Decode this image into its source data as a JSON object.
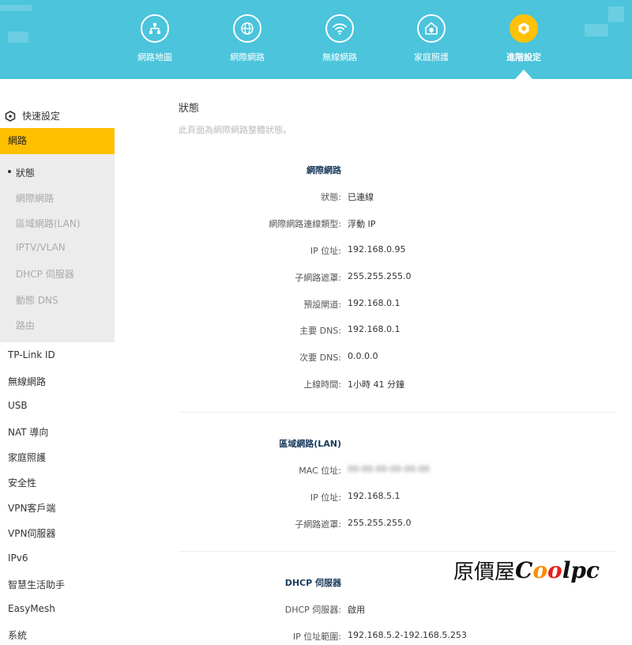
{
  "nav": {
    "tabs": [
      {
        "label": "網路地圖",
        "icon": "network-map-icon"
      },
      {
        "label": "網際網路",
        "icon": "globe-icon"
      },
      {
        "label": "無線網路",
        "icon": "wifi-icon"
      },
      {
        "label": "家庭照護",
        "icon": "home-shield-icon"
      },
      {
        "label": "進階設定",
        "icon": "gear-icon",
        "active": true
      }
    ],
    "active_color": "#ffc107",
    "bar_color": "#4bc4dc"
  },
  "sidebar": {
    "quick_setup": "快速設定",
    "active_category": "網路",
    "sub_items": [
      "狀態",
      "網際網路",
      "區域網路(LAN)",
      "IPTV/VLAN",
      "DHCP 伺服器",
      "動態 DNS",
      "路由"
    ],
    "items": [
      "TP-Link ID",
      "無線網路",
      "USB",
      "NAT 導向",
      "家庭照護",
      "安全性",
      "VPN客戶端",
      "VPN伺服器",
      "IPv6",
      "智慧生活助手",
      "EasyMesh",
      "系統"
    ]
  },
  "main": {
    "title": "狀態",
    "description": "此頁面為網際網路整體狀態。",
    "internet": {
      "title": "網際網路",
      "rows": [
        {
          "label": "狀態:",
          "value": "已連線"
        },
        {
          "label": "網際網路連線類型:",
          "value": "浮動 IP"
        },
        {
          "label": "IP 位址:",
          "value": "192.168.0.95"
        },
        {
          "label": "子網路遮罩:",
          "value": "255.255.255.0"
        },
        {
          "label": "預設閘道:",
          "value": "192.168.0.1"
        },
        {
          "label": "主要 DNS:",
          "value": "192.168.0.1"
        },
        {
          "label": "次要 DNS:",
          "value": "0.0.0.0"
        },
        {
          "label": "上線時間:",
          "value": "1小時 41 分鐘"
        }
      ]
    },
    "lan": {
      "title": "區域網路(LAN)",
      "rows": [
        {
          "label": "MAC 位址:",
          "value": "00-00-00-00-00-00",
          "blurred": true
        },
        {
          "label": "IP 位址:",
          "value": "192.168.5.1"
        },
        {
          "label": "子網路遮罩:",
          "value": "255.255.255.0"
        }
      ]
    },
    "dhcp": {
      "title": "DHCP 伺服器",
      "rows": [
        {
          "label": "DHCP 伺服器:",
          "value": "啟用"
        },
        {
          "label": "IP 位址範圍:",
          "value": "192.168.5.2-192.168.5.253"
        }
      ]
    }
  },
  "watermark": {
    "prefix": "原價屋",
    "c": "C",
    "o1": "o",
    "o2": "o",
    "suffix": "lpc"
  }
}
